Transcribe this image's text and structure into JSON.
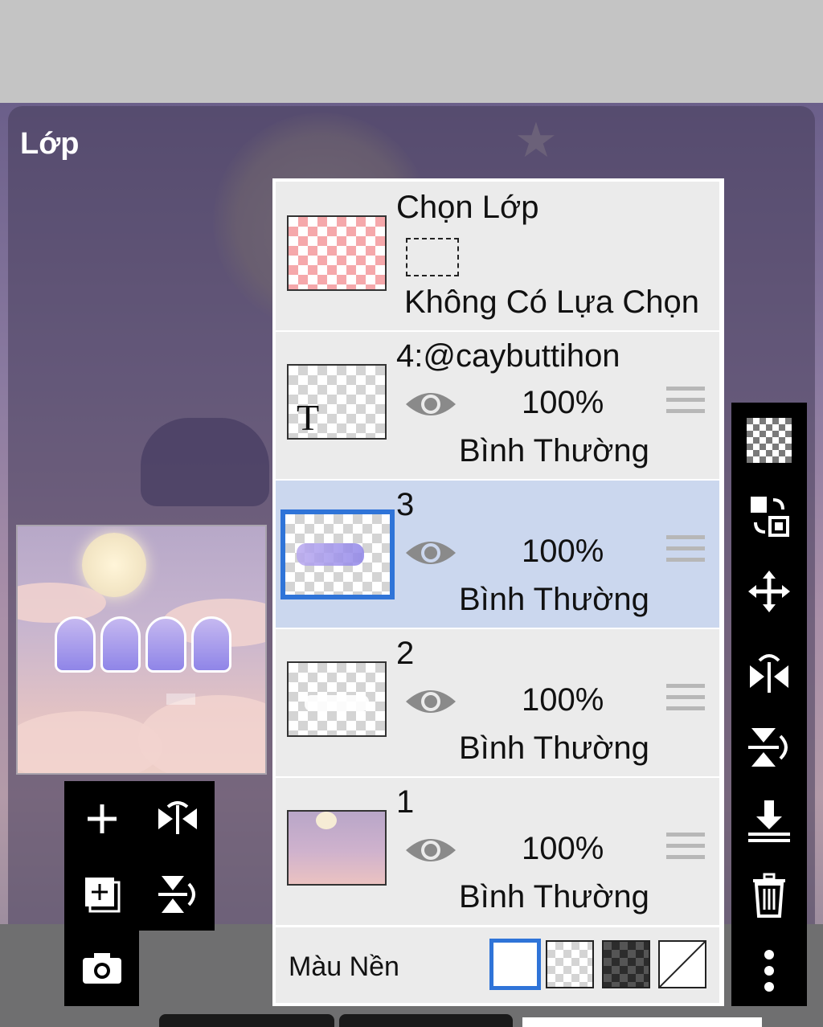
{
  "panel": {
    "title": "Lớp"
  },
  "selection_layer": {
    "title": "Chọn Lớp",
    "status": "Không Có Lựa Chọn"
  },
  "layers": [
    {
      "name": "4:@caybuttihon",
      "opacity": "100%",
      "blend": "Bình Thường",
      "thumb_glyph": "T",
      "selected": false,
      "visible": true
    },
    {
      "name": "3",
      "opacity": "100%",
      "blend": "Bình Thường",
      "selected": true,
      "visible": true
    },
    {
      "name": "2",
      "opacity": "100%",
      "blend": "Bình Thường",
      "selected": false,
      "visible": true
    },
    {
      "name": "1",
      "opacity": "100%",
      "blend": "Bình Thường",
      "selected": false,
      "visible": true
    }
  ],
  "background": {
    "label": "Màu Nền",
    "options": [
      "white",
      "transparent",
      "dark-checker",
      "none"
    ],
    "selected": "white"
  },
  "left_tools": [
    "add-layer-icon",
    "flip-horizontal-icon",
    "duplicate-layer-icon",
    "flip-vertical-icon",
    "camera-icon"
  ],
  "right_tools": [
    "transparency-icon",
    "layer-swap-icon",
    "move-icon",
    "flip-horizontal-icon",
    "flip-vertical-icon",
    "merge-down-icon",
    "trash-icon",
    "more-icon"
  ],
  "colors": {
    "accent": "#2f74d8",
    "selected_row": "#cbd7ee",
    "row_bg": "#ebebeb"
  }
}
